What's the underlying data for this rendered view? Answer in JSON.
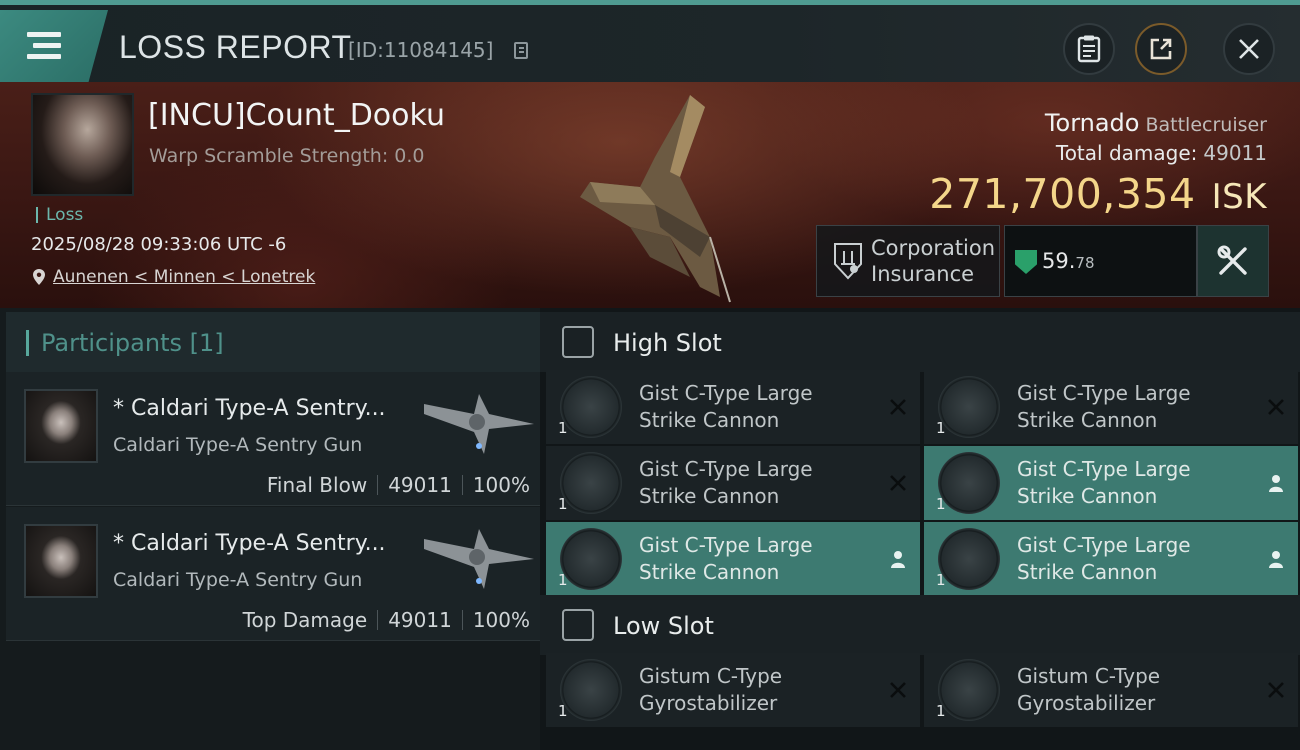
{
  "topbar": {
    "title": "LOSS REPORT",
    "report_id": "[ID:11084145]"
  },
  "victim": {
    "name": "[INCU]Count_Dooku",
    "scramble": "Warp Scramble Strength: 0.0",
    "status": "Loss",
    "timestamp": "2025/08/28 09:33:06 UTC -6",
    "location": "Aunenen < Minnen < Lonetrek"
  },
  "ship": {
    "name": "Tornado",
    "class": "Battlecruiser",
    "total_damage_label": "Total damage:",
    "total_damage": "49011",
    "value": "271,700,354",
    "value_unit": "ISK"
  },
  "insurance": {
    "line1": "Corporation",
    "line2": "Insurance"
  },
  "security": {
    "main": "59.",
    "decimal": "78"
  },
  "participants": {
    "header": "Participants [1]",
    "items": [
      {
        "name": "* Caldari Type-A Sentry...",
        "corp": "Caldari Type-A Sentry Gun",
        "role": "Final Blow",
        "damage": "49011",
        "percent": "100%"
      },
      {
        "name": "* Caldari Type-A Sentry...",
        "corp": "Caldari Type-A Sentry Gun",
        "role": "Top Damage",
        "damage": "49011",
        "percent": "100%"
      }
    ]
  },
  "slots": {
    "high": {
      "label": "High Slot",
      "modules": [
        {
          "line1": "Gist C-Type Large",
          "line2": "Strike Cannon",
          "qty": "1",
          "status": "destroyed"
        },
        {
          "line1": "Gist C-Type Large",
          "line2": "Strike Cannon",
          "qty": "1",
          "status": "destroyed"
        },
        {
          "line1": "Gist C-Type Large",
          "line2": "Strike Cannon",
          "qty": "1",
          "status": "destroyed"
        },
        {
          "line1": "Gist C-Type Large",
          "line2": "Strike Cannon",
          "qty": "1",
          "status": "dropped"
        },
        {
          "line1": "Gist C-Type Large",
          "line2": "Strike Cannon",
          "qty": "1",
          "status": "dropped"
        },
        {
          "line1": "Gist C-Type Large",
          "line2": "Strike Cannon",
          "qty": "1",
          "status": "dropped"
        }
      ]
    },
    "low": {
      "label": "Low Slot",
      "modules": [
        {
          "line1": "Gistum C-Type",
          "line2": "Gyrostabilizer",
          "qty": "1",
          "status": "destroyed"
        },
        {
          "line1": "Gistum C-Type",
          "line2": "Gyrostabilizer",
          "qty": "1",
          "status": "destroyed"
        }
      ]
    }
  },
  "colors": {
    "accent": "#4f9b91",
    "isk": "#f4d68a",
    "fitted_row": "#3d7a71",
    "security": "#2aa06a"
  }
}
